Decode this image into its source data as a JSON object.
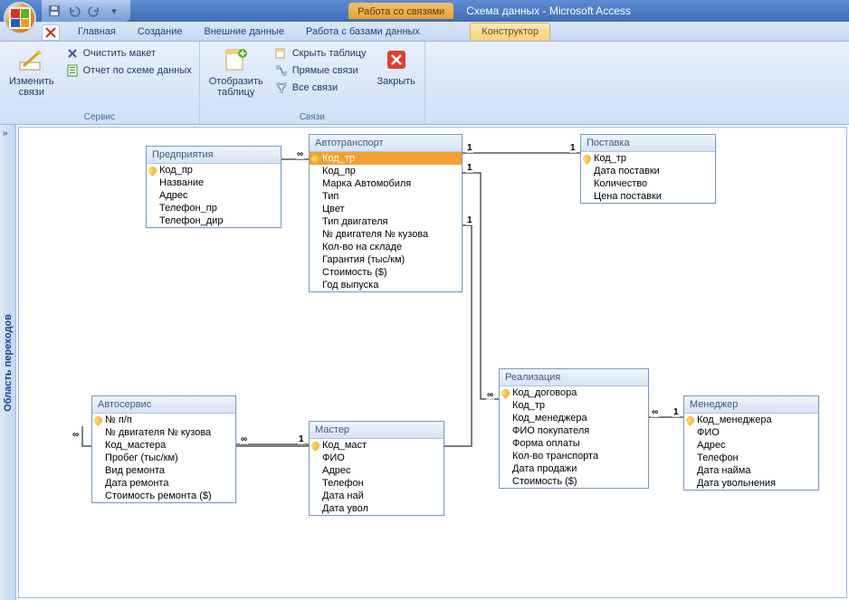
{
  "title": {
    "context_group": "Работа со связями",
    "app": "Схема данных - Microsoft Access"
  },
  "tabs": {
    "home": "Главная",
    "create": "Создание",
    "external": "Внешние данные",
    "dbtools": "Работа с базами данных",
    "design": "Конструктор"
  },
  "ribbon": {
    "g1": {
      "edit": "Изменить\nсвязи",
      "clear": "Очистить макет",
      "report": "Отчет по схеме данных",
      "label": "Сервис"
    },
    "g2": {
      "show_table": "Отобразить\nтаблицу",
      "hide_table": "Скрыть таблицу",
      "direct": "Прямые связи",
      "all": "Все связи",
      "close": "Закрыть",
      "label": "Связи"
    }
  },
  "navpane": {
    "label": "Область переходов"
  },
  "tables": {
    "pred": {
      "title": "Предприятия",
      "fields": [
        "Код_пр",
        "Название",
        "Адрес",
        "Телефон_пр",
        "Телефон_дир"
      ],
      "pk": [
        0
      ]
    },
    "avto": {
      "title": "Автотранспорт",
      "fields": [
        "Код_тр",
        "Код_пр",
        "Марка Автомобиля",
        "Тип",
        "Цвет",
        "Тип двигателя",
        "№ двигателя № кузова",
        "Кол-во на складе",
        "Гарантия  (тыс/км)",
        "Стоимость ($)",
        "Год выпуска"
      ],
      "pk": [
        0
      ]
    },
    "post": {
      "title": "Поставка",
      "fields": [
        "Код_тр",
        "Дата поставки",
        "Количество",
        "Цена поставки"
      ],
      "pk": [
        0
      ]
    },
    "serv": {
      "title": "Автосервис",
      "fields": [
        "№ п/п",
        "№ двигателя № кузова",
        "Код_мастера",
        "Пробег (тыс/км)",
        "Вид ремонта",
        "Дата ремонта",
        "Стоимость ремонта ($)"
      ],
      "pk": [
        0
      ]
    },
    "master": {
      "title": "Мастер",
      "fields": [
        "Код_маст",
        "ФИО",
        "Адрес",
        "Телефон",
        "Дата най",
        "Дата увол"
      ],
      "pk": [
        0
      ]
    },
    "real": {
      "title": "Реализация",
      "fields": [
        "Код_договора",
        "Код_тр",
        "Код_менеджера",
        "ФИО покупателя",
        "Форма оплаты",
        "Кол-во транспорта",
        "Дата продажи",
        "Стоимость ($)"
      ],
      "pk": [
        0
      ]
    },
    "mgr": {
      "title": "Менеджер",
      "fields": [
        "Код_менеджера",
        "ФИО",
        "Адрес",
        "Телефон",
        "Дата найма",
        "Дата увольнения"
      ],
      "pk": [
        0
      ]
    }
  },
  "rel_labels": {
    "one": "1",
    "many": "∞"
  }
}
